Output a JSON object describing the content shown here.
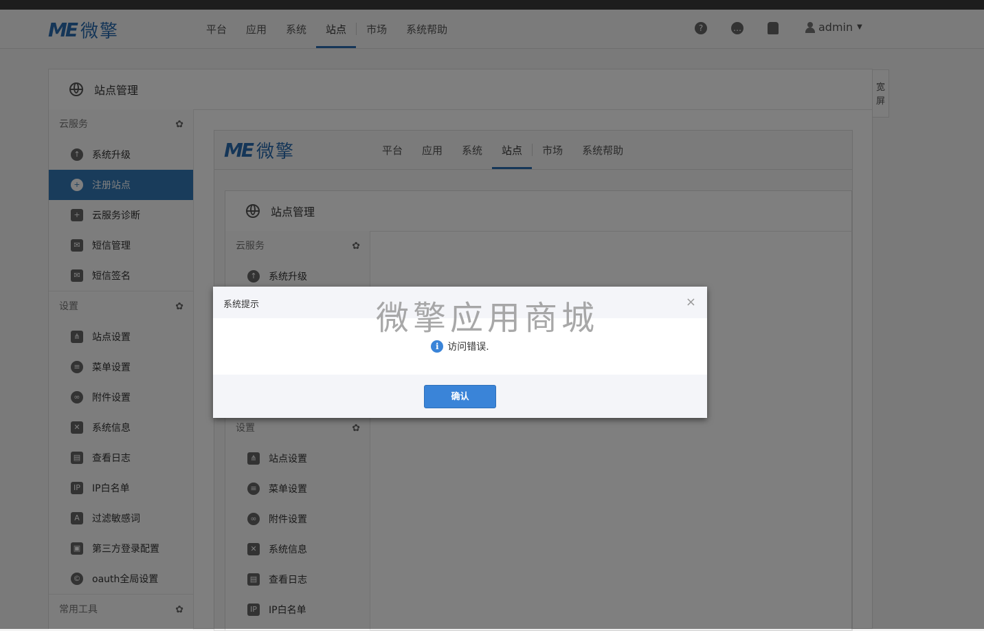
{
  "brand": {
    "logo_mark": "ME",
    "logo_text": "微擎"
  },
  "nav": {
    "items": [
      "平台",
      "应用",
      "系统",
      "站点",
      "市场",
      "系统帮助"
    ],
    "active_index": 3
  },
  "navbar_icons": [
    "question-icon",
    "message-icon",
    "bell-icon"
  ],
  "user": {
    "name": "admin"
  },
  "panel": {
    "title": "站点管理"
  },
  "wide_button": {
    "label": "宽屏"
  },
  "sidebar": {
    "groups": [
      {
        "title": "云服务",
        "items": [
          {
            "label": "系统升级",
            "icon": "cloud-upload-icon"
          },
          {
            "label": "注册站点",
            "icon": "plus-circle-icon",
            "active": true
          },
          {
            "label": "云服务诊断",
            "icon": "medkit-icon"
          },
          {
            "label": "短信管理",
            "icon": "envelope-icon"
          },
          {
            "label": "短信签名",
            "icon": "envelope-icon"
          }
        ]
      },
      {
        "title": "设置",
        "items": [
          {
            "label": "站点设置",
            "icon": "sitemap-icon"
          },
          {
            "label": "菜单设置",
            "icon": "list-icon"
          },
          {
            "label": "附件设置",
            "icon": "link-icon"
          },
          {
            "label": "系统信息",
            "icon": "tools-icon"
          },
          {
            "label": "查看日志",
            "icon": "log-icon"
          },
          {
            "label": "IP白名单",
            "icon": "ip-icon"
          },
          {
            "label": "过滤敏感词",
            "icon": "filter-icon"
          },
          {
            "label": "第三方登录配置",
            "icon": "lock-icon"
          },
          {
            "label": "oauth全局设置",
            "icon": "oauth-icon"
          }
        ]
      },
      {
        "title": "常用工具",
        "items": []
      }
    ]
  },
  "inner_sidebar": {
    "groups": [
      {
        "title": "云服务",
        "items": [
          {
            "label": "系统升级"
          }
        ]
      },
      {
        "title": "设置",
        "items": [
          {
            "label": "站点设置"
          },
          {
            "label": "菜单设置"
          },
          {
            "label": "附件设置"
          },
          {
            "label": "系统信息"
          },
          {
            "label": "查看日志"
          },
          {
            "label": "IP白名单"
          }
        ]
      }
    ]
  },
  "modal": {
    "title": "系统提示",
    "watermark": "微擎应用商城",
    "message": "访问错误.",
    "confirm_label": "确认",
    "close_glyph": "×"
  }
}
